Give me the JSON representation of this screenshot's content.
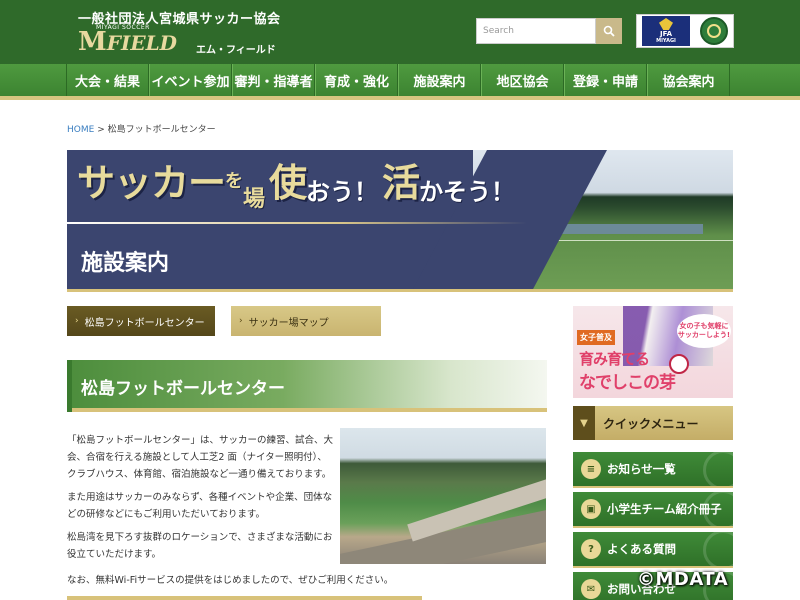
{
  "header": {
    "org_name": "一般社団法人宮城県サッカー協会",
    "logo_small": "MIYAGI SOCCER",
    "logo_main": "FIELD",
    "logo_m": "M",
    "logo_sub": "エム・フィールド",
    "search_placeholder": "Search",
    "badges": {
      "jfa": "JFA",
      "jfa_sub": "MIYAGI"
    }
  },
  "nav": {
    "items": [
      "大会・結果",
      "イベント参加",
      "審判・指導者",
      "育成・強化",
      "施設案内",
      "地区協会",
      "登録・申請",
      "協会案内"
    ]
  },
  "breadcrumb": {
    "home": "HOME",
    "separator": ">",
    "current": "松島フットボールセンター"
  },
  "hero": {
    "slogan": {
      "w1": "サッカー",
      "w2": "を",
      "w3": "場",
      "w4": "使",
      "w5": "おう！",
      "w6": "活",
      "w7": "かそう！"
    },
    "title": "施設案内"
  },
  "subnav": {
    "items": [
      "松島フットボールセンター",
      "サッカー場マップ"
    ],
    "arrow": "›"
  },
  "section": {
    "title": "松島フットボールセンター"
  },
  "content": {
    "paragraphs": [
      "「松島フットボールセンター」は、サッカーの練習、試合、大会、合宿を行える施設として人工芝2 面（ナイター照明付）、クラブハウス、体育館、宿泊施設など一通り備えております。",
      "また用途はサッカーのみならず、各種イベントや企業、団体などの研修などにもご利用いただいております。",
      "松島湾を見下ろす抜群のロケーションで、さまざまな活動にお役立ていただけます。"
    ],
    "note": "なお、無料Wi-Fiサービスの提供をはじめましたので、ぜひご利用ください。"
  },
  "sidebar": {
    "promo": {
      "tag": "女子普及",
      "line1": "育み育てる",
      "line2": "なでしこの芽",
      "bubble": "女の子も気軽にサッカーしよう!"
    },
    "quick_menu": {
      "label": "クイックメニュー",
      "icon": "chevron-down-icon"
    },
    "items": [
      {
        "label": "お知らせ一覧",
        "icon": "list-icon"
      },
      {
        "label": "小学生チーム紹介冊子",
        "icon": "book-icon"
      },
      {
        "label": "よくある質問",
        "icon": "question-icon"
      },
      {
        "label": "お問い合わせ",
        "icon": "mail-icon"
      }
    ]
  },
  "watermark": "©MDATA",
  "colors": {
    "header_green": "#2f6a2a",
    "nav_green": "#4f9a3f",
    "gold": "#d8c27a",
    "hero_navy": "#3b456f"
  }
}
